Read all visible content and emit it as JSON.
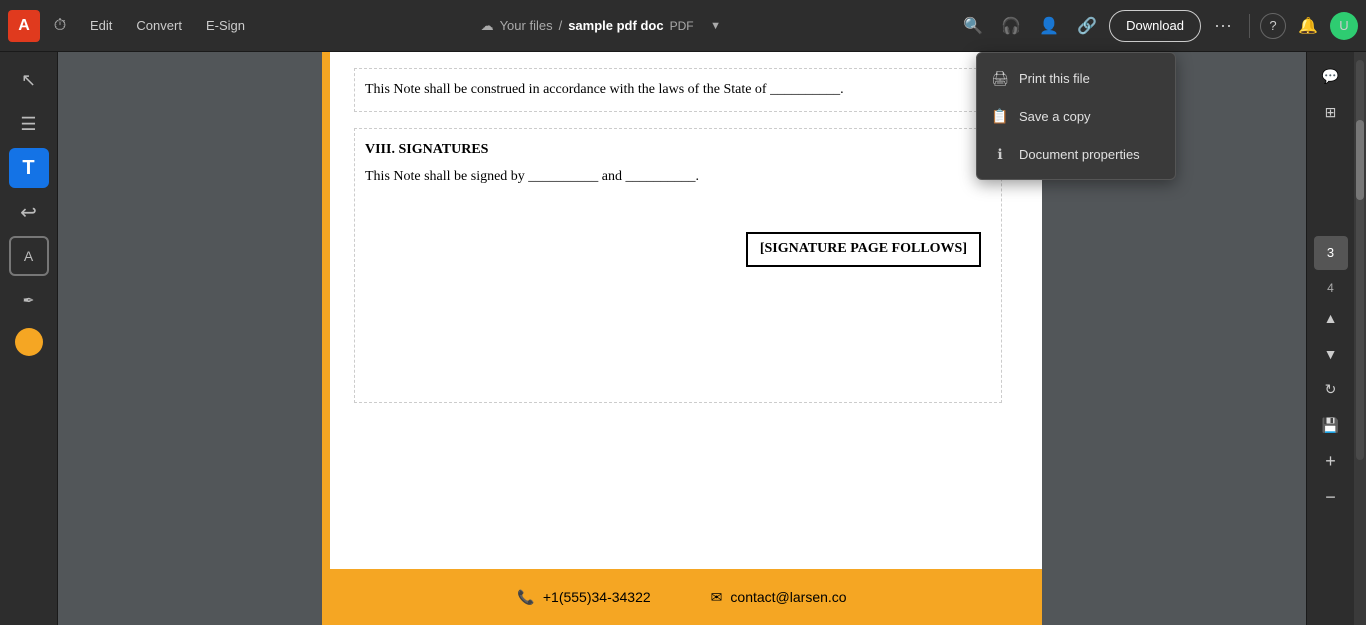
{
  "toolbar": {
    "logo": "A",
    "edit_label": "Edit",
    "convert_label": "Convert",
    "esign_label": "E-Sign",
    "breadcrumb_prefix": "Your files",
    "breadcrumb_separator": "/",
    "filename": "sample pdf doc",
    "filetype": "PDF",
    "download_label": "Download",
    "more_icon": "•••",
    "help_icon": "?",
    "notification_icon": "🔔",
    "user_icon": "👤"
  },
  "dropdown": {
    "items": [
      {
        "id": "print",
        "label": "Print this file",
        "icon": "🖨"
      },
      {
        "id": "save-copy",
        "label": "Save a copy",
        "icon": "📋"
      },
      {
        "id": "doc-props",
        "label": "Document properties",
        "icon": "ℹ"
      }
    ]
  },
  "pdf": {
    "paragraph1": "This Note shall be construed in accordance with the laws of the State of __________.",
    "section_title": "VIII. SIGNATURES",
    "paragraph2": "This Note shall be signed by __________ and __________.",
    "signature_box": "[SIGNATURE PAGE FOLLOWS]",
    "footer_phone": "+1(555)34-34322",
    "footer_email": "contact@larsen.co"
  },
  "left_tools": [
    {
      "id": "select",
      "icon": "↖",
      "label": "Select tool",
      "active": false
    },
    {
      "id": "hand",
      "icon": "☰",
      "label": "Hand tool",
      "active": false
    },
    {
      "id": "text",
      "icon": "T",
      "label": "Text tool",
      "active": true
    },
    {
      "id": "undo",
      "icon": "↩",
      "label": "Undo",
      "active": false
    },
    {
      "id": "select-text",
      "icon": "⊡",
      "label": "Select text",
      "active": false
    },
    {
      "id": "draw",
      "icon": "✏",
      "label": "Draw",
      "active": false
    },
    {
      "id": "color",
      "icon": "●",
      "label": "Color picker",
      "active": false
    }
  ],
  "right_tools": [
    {
      "id": "comment",
      "icon": "💬",
      "label": "Comment"
    },
    {
      "id": "grid",
      "icon": "⊞",
      "label": "Grid"
    }
  ],
  "page_thumbs": [
    {
      "id": "page3",
      "label": "3",
      "active": true
    },
    {
      "id": "page4",
      "label": "4",
      "active": false
    }
  ],
  "nav": {
    "up_icon": "▲",
    "down_icon": "▼",
    "refresh_icon": "↻",
    "save_icon": "💾",
    "zoom_in_icon": "+",
    "zoom_out_icon": "−"
  }
}
